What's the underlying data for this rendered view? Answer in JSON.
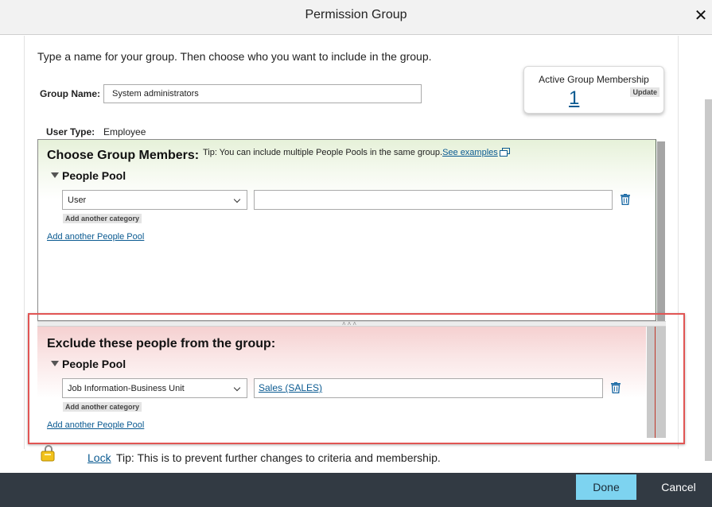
{
  "dialog": {
    "title": "Permission Group"
  },
  "intro": "Type a name for your group. Then choose who you want to include in the group.",
  "group_name": {
    "label": "Group Name:",
    "value": "System administrators"
  },
  "membership": {
    "title": "Active Group Membership",
    "count": "1",
    "update_label": "Update"
  },
  "user_type": {
    "label": "User Type:",
    "value": "Employee"
  },
  "include": {
    "title": "Choose Group Members:",
    "tip": "Tip: You can include multiple People Pools in the same group.",
    "see_examples": "See examples",
    "pool_heading": "People Pool",
    "category": "User",
    "value": "",
    "add_category": "Add another category",
    "add_pool": "Add another People Pool"
  },
  "exclude": {
    "title": "Exclude these people from the group:",
    "pool_heading": "People Pool",
    "category": "Job Information-Business Unit",
    "value": "Sales (SALES)",
    "add_category": "Add another category",
    "add_pool": "Add another People Pool"
  },
  "lock": {
    "link": "Lock",
    "tip": "Tip: This is to prevent further changes to criteria and membership."
  },
  "footer": {
    "done_label": "Done",
    "cancel_label": "Cancel"
  },
  "colors": {
    "footer_bg": "#323a43",
    "done_bg": "#7dd3f0",
    "link": "#0a5a91",
    "highlight": "#e15554"
  },
  "icons": {
    "close": "close-icon",
    "delete": "trash-icon",
    "lock": "lock-icon",
    "external": "external-link-icon",
    "expand": "triangle-down-icon",
    "dropdown": "chevron-down-icon"
  }
}
